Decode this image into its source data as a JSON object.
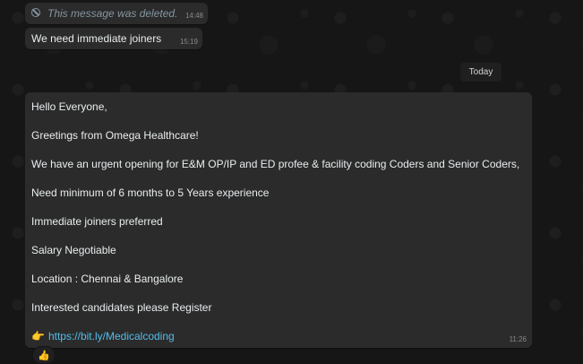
{
  "messages": {
    "deleted": {
      "text": "This message was deleted.",
      "time": "14:48",
      "icon": "blocked-icon"
    },
    "joiners": {
      "text": "We need immediate joiners",
      "time": "15:19"
    },
    "date_separator": "Today",
    "main": {
      "lines": [
        "Hello Everyone,",
        "Greetings from Omega Healthcare!",
        "We have an urgent opening for E&M OP/IP and ED profee & facility coding Coders and Senior Coders,",
        "Need minimum of 6 months to 5 Years experience",
        "Immediate joiners preferred",
        "Salary Negotiable",
        "Location : Chennai & Bangalore",
        "Interested candidates please Register"
      ],
      "link_emoji": "👉",
      "link": "https://bit.ly/Medicalcoding",
      "time": "11:26",
      "reaction": "👍"
    }
  }
}
